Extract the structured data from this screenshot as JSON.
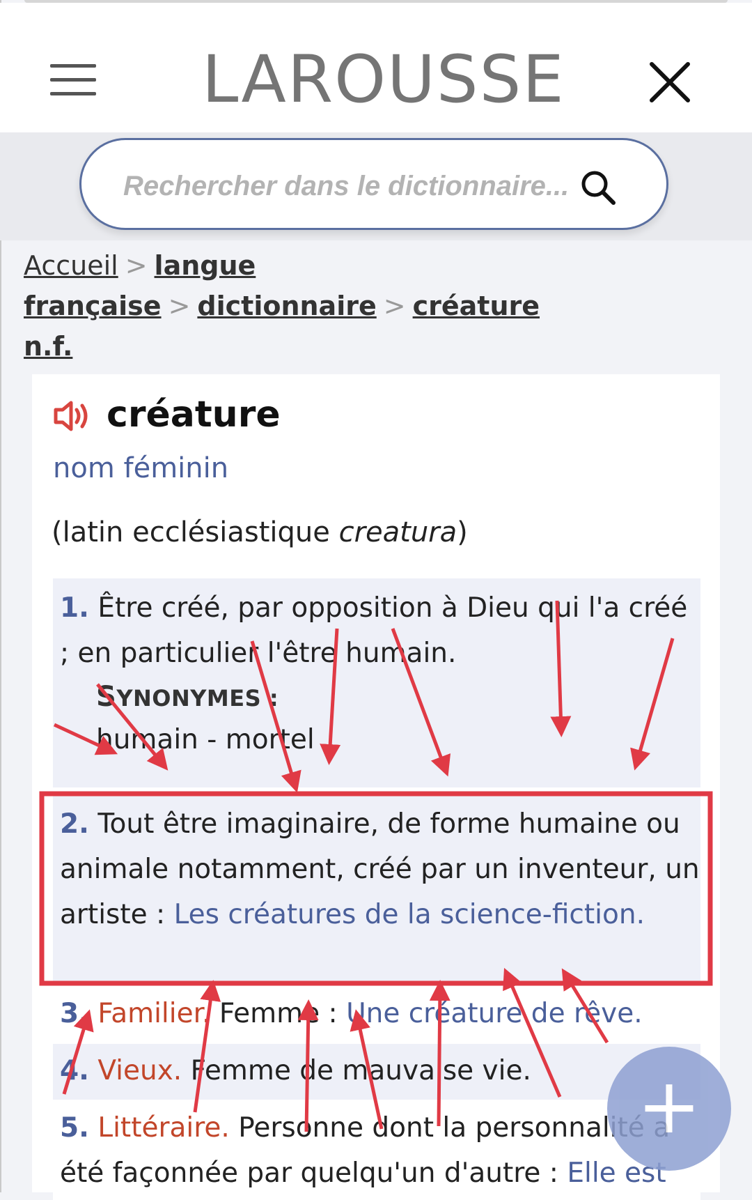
{
  "header": {
    "logo": "LAROUSSE",
    "menu_icon": "hamburger-menu-icon",
    "close_icon": "close-icon"
  },
  "search": {
    "placeholder": "Rechercher dans le dictionnaire...",
    "icon": "search-icon"
  },
  "breadcrumb": {
    "items": [
      "Accueil",
      "langue française",
      "dictionnaire",
      "créature",
      "n.f."
    ],
    "separator": ">"
  },
  "entry": {
    "word": "créature",
    "pos": "nom féminin",
    "etym_prefix": "(latin ecclésiastique ",
    "etym_word": "creatura",
    "etym_suffix": ")",
    "audio_icon": "speaker-icon",
    "definitions": [
      {
        "num": "1.",
        "text": " Être créé, par opposition à Dieu qui l'a créé ; en particulier l'être humain.",
        "synonyms_title_cap": "S",
        "synonyms_title_rest": "YNONYMES :",
        "synonyms": "humain - mortel"
      },
      {
        "num": "2.",
        "text": " Tout être imaginaire, de forme humaine ou animale notamment, créé par un inventeur, un artiste : ",
        "example": "Les créatures de la science-fiction."
      },
      {
        "num": "3.",
        "register": " Familier.",
        "text": " Femme : ",
        "example": "Une créature de rêve."
      },
      {
        "num": "4.",
        "register": " Vieux.",
        "text": " Femme de mauvaise vie."
      },
      {
        "num": "5.",
        "register": " Littéraire.",
        "text": " Personne dont la personnalité a été façonnée par quelqu'un d'autre : ",
        "example": "Elle est"
      }
    ]
  },
  "fab": {
    "label": "+",
    "icon": "plus-icon"
  },
  "annotation": {
    "color": "#e03a45",
    "highlight": "definition 2"
  }
}
